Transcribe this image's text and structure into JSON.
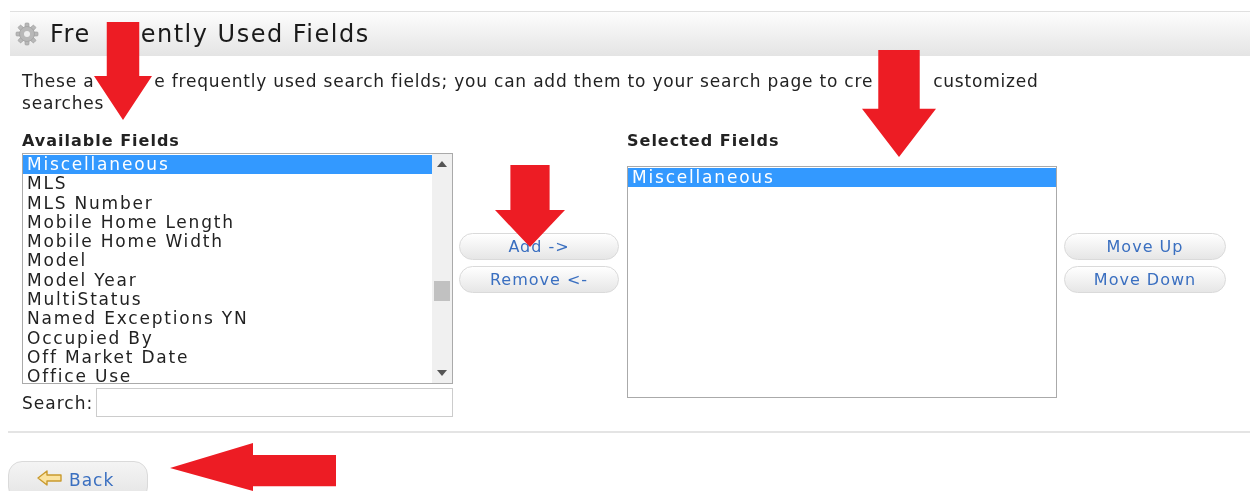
{
  "header": {
    "title_parts": [
      "Fre",
      "ently Used Fields"
    ]
  },
  "description": {
    "lines": [
      [
        "These a",
        "e frequently used search fields; you can add them to your search page to cre",
        "customized"
      ],
      [
        "searches"
      ]
    ]
  },
  "available": {
    "label": "Available Fields",
    "items": [
      {
        "label": "Miscellaneous",
        "selected": true
      },
      {
        "label": "MLS",
        "selected": false
      },
      {
        "label": "MLS Number",
        "selected": false
      },
      {
        "label": "Mobile Home Length",
        "selected": false
      },
      {
        "label": "Mobile Home Width",
        "selected": false
      },
      {
        "label": "Model",
        "selected": false
      },
      {
        "label": "Model Year",
        "selected": false
      },
      {
        "label": "MultiStatus",
        "selected": false
      },
      {
        "label": "Named Exceptions YN",
        "selected": false
      },
      {
        "label": "Occupied By",
        "selected": false
      },
      {
        "label": "Off Market Date",
        "selected": false
      },
      {
        "label": "Office Use",
        "selected": false
      }
    ],
    "search_label": "Search:"
  },
  "transfer_buttons": [
    "Add ->",
    "Remove <-"
  ],
  "selected": {
    "label": "Selected Fields",
    "items": [
      {
        "label": "Miscellaneous",
        "selected": true
      }
    ]
  },
  "order_buttons": [
    "Move Up",
    "Move Down"
  ],
  "back_button": "Back",
  "annotations": [
    {
      "kind": "down-arrow"
    },
    {
      "kind": "down-arrow"
    },
    {
      "kind": "down-arrow"
    },
    {
      "kind": "left-arrow"
    }
  ]
}
